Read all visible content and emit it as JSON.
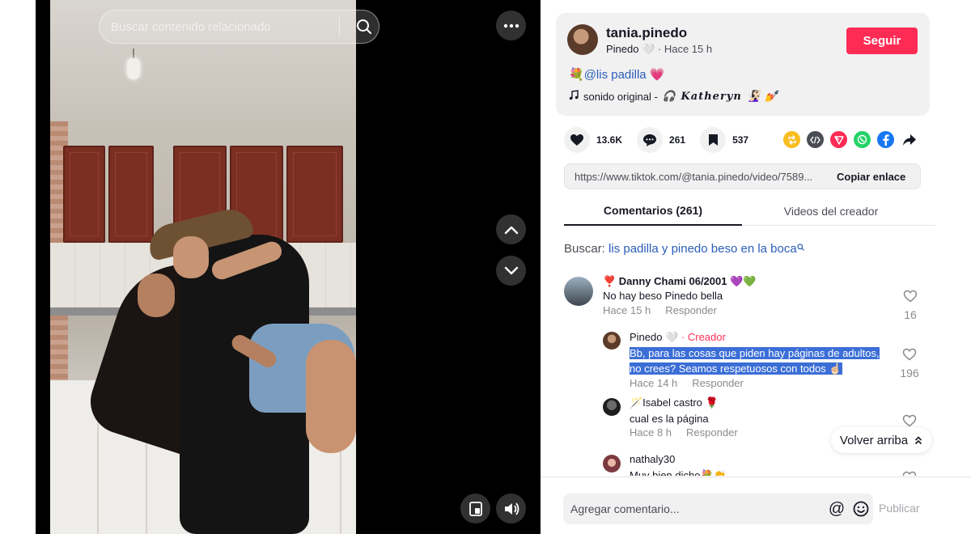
{
  "video": {
    "search_placeholder": "Buscar contenido relacionado"
  },
  "author": {
    "username": "tania.pinedo",
    "nickname": "Pinedo 🤍",
    "time_ago": "· Hace 15 h",
    "follow_label": "Seguir",
    "desc_emoji": "💐",
    "desc_mention": "@lis padilla",
    "desc_heart": "💗",
    "music_prefix": "sonido original -",
    "music_name": "🎧 𝑲𝒂𝒕𝒉𝒆𝒓𝒚𝒏 🧏🏻‍♀️ 💅"
  },
  "actions": {
    "likes": "13.6K",
    "comments": "261",
    "saves": "537"
  },
  "share": {
    "url": "https://www.tiktok.com/@tania.pinedo/video/7589...",
    "copy_label": "Copiar enlace"
  },
  "tabs": {
    "comments": "Comentarios (261)",
    "creator_videos": "Videos del creador"
  },
  "search_related": {
    "label": "Buscar:",
    "query": "lis padilla y pinedo beso en la boca"
  },
  "comments": [
    {
      "user": "❣️ Danny Chami 06/2001 💜💚",
      "text": "No hay beso Pinedo bella",
      "time": "Hace 15 h",
      "reply": "Responder",
      "likes": "16"
    },
    {
      "user": "Pinedo 🤍",
      "badge": "· Creador",
      "text_line1": "Bb, para las cosas que piden hay páginas de adultos,",
      "text_line2": "no crees? Seamos respetuosos con todos ☝🏻",
      "time": "Hace 14 h",
      "reply": "Responder",
      "likes": "196"
    },
    {
      "user": "🪄Isabel castro 🌹",
      "text": "cual es la página",
      "time": "Hace 8 h",
      "reply": "Responder"
    },
    {
      "user": "nathaly30",
      "text": "Muy bien dicho💐👏"
    }
  ],
  "back_to_top": "Volver arriba",
  "composer": {
    "placeholder": "Agregar comentario...",
    "publish_label": "Publicar"
  },
  "colors": {
    "accent": "#fe2c55",
    "link": "#2b5db9",
    "highlight": "#3b6ed6"
  }
}
